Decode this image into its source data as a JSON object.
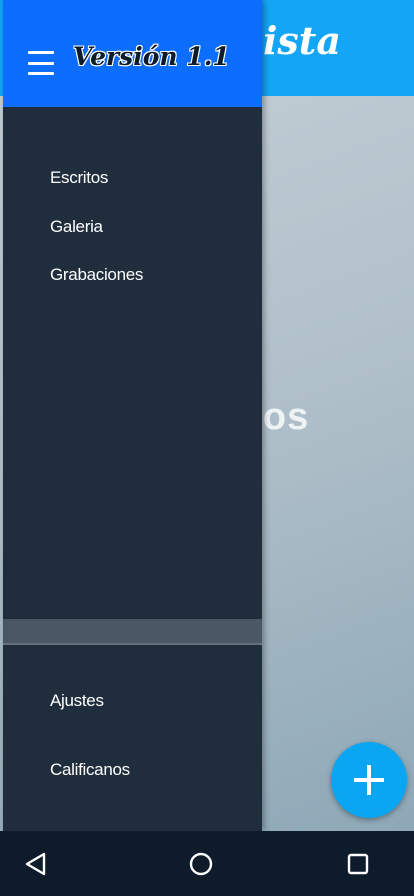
{
  "app": {
    "title_visible": "onista",
    "body_text_visible": "otos",
    "header_color": "#14a6f5",
    "fab_icon": "plus-icon",
    "fab_color": "#0aa6f2"
  },
  "drawer": {
    "menu_icon": "hamburger-menu-icon",
    "version_label": "Versión 1.1",
    "header_color": "#0d6efd",
    "background_color": "#1f2d3d",
    "items": [
      {
        "label": "Escritos"
      },
      {
        "label": "Galeria"
      },
      {
        "label": "Grabaciones"
      }
    ],
    "footer_items": [
      {
        "label": "Ajustes"
      },
      {
        "label": "Calificanos"
      }
    ]
  },
  "navbar": {
    "buttons": [
      {
        "icon": "back-triangle-icon"
      },
      {
        "icon": "home-circle-icon"
      },
      {
        "icon": "recents-square-icon"
      }
    ]
  }
}
